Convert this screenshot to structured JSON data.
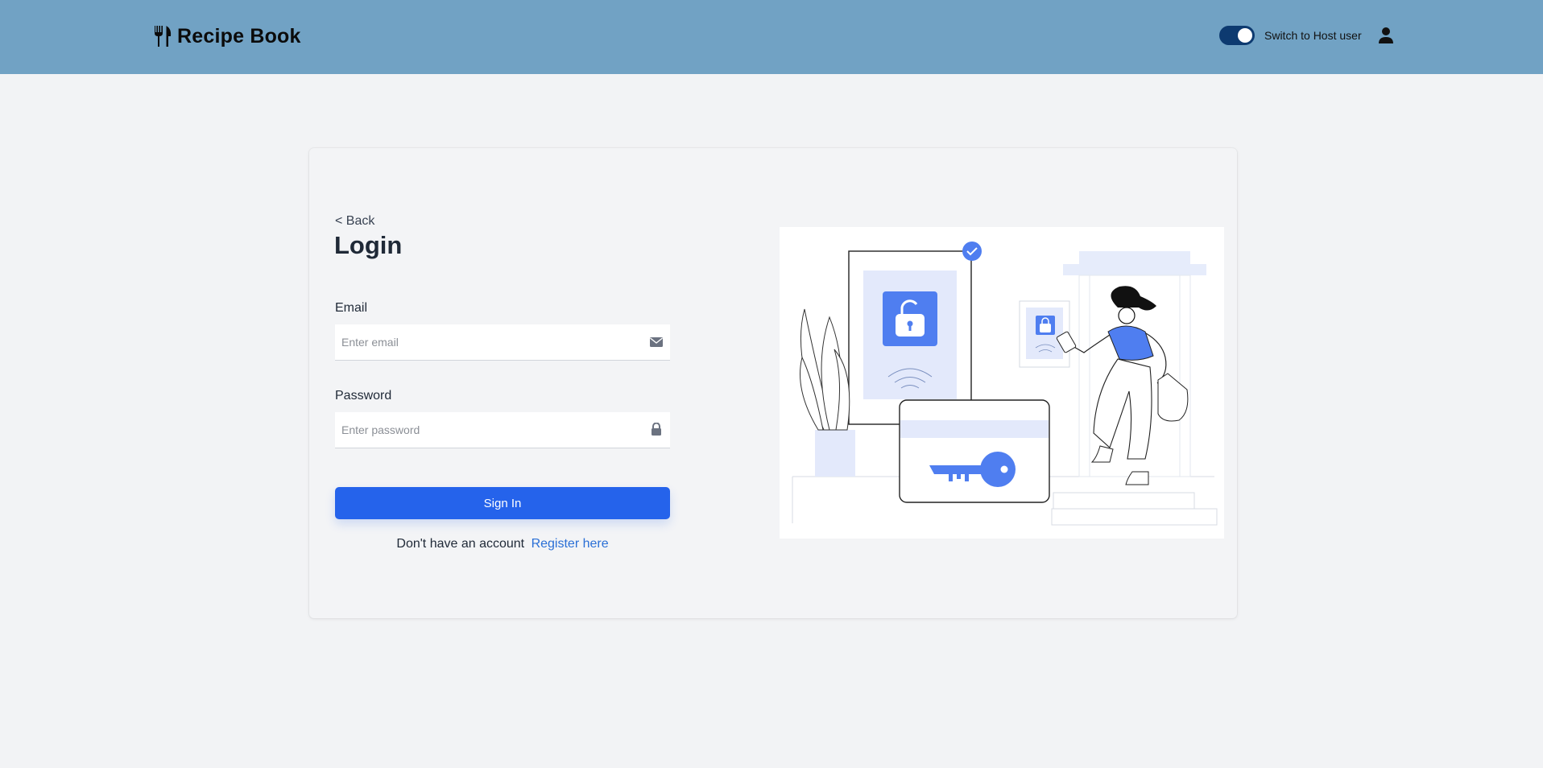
{
  "navbar": {
    "brand": "Recipe Book",
    "toggle_label": "Switch to Host user",
    "toggle_on": true
  },
  "login": {
    "back": "< Back",
    "title": "Login",
    "email_label": "Email",
    "email_placeholder": "Enter email",
    "password_label": "Password",
    "password_placeholder": "Enter password",
    "sign_in": "Sign In",
    "no_account": "Don't have an account",
    "register": "Register here"
  },
  "icons": {
    "brand": "fork-knife-icon",
    "user": "user-icon",
    "email": "envelope-icon",
    "password": "lock-icon"
  },
  "colors": {
    "navbar": "#71a2c4",
    "primary": "#2563eb",
    "link": "#2a6fd6",
    "illustration_accent": "#4f7ef0",
    "illustration_light": "#e3e9fb"
  }
}
